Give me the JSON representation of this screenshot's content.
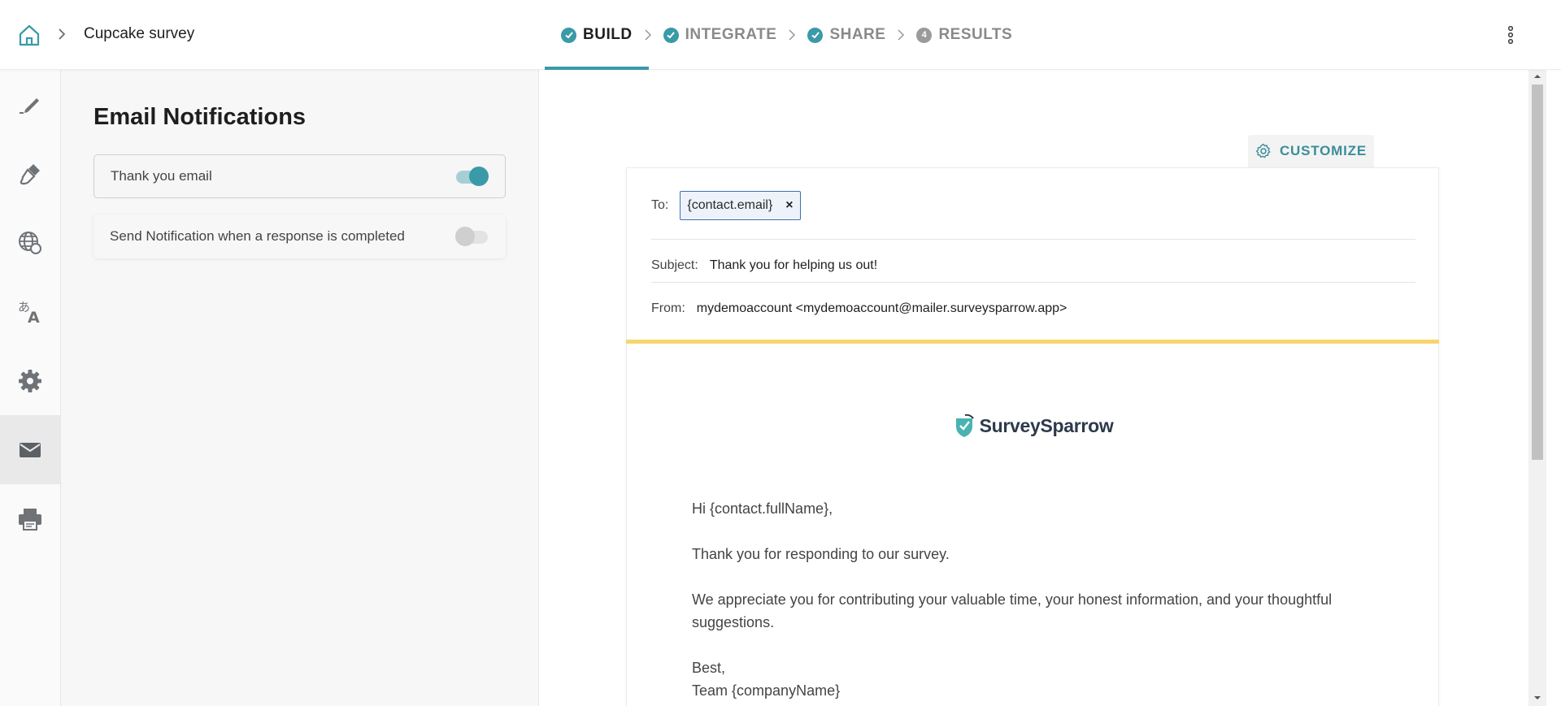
{
  "header": {
    "survey_title": "Cupcake survey",
    "steps": [
      {
        "label": "BUILD",
        "state": "done",
        "active": true
      },
      {
        "label": "INTEGRATE",
        "state": "done"
      },
      {
        "label": "SHARE",
        "state": "done"
      },
      {
        "label": "RESULTS",
        "state": "pending",
        "number": "4"
      }
    ]
  },
  "sidebar": {
    "items": [
      {
        "icon": "pen-icon"
      },
      {
        "icon": "paint-brush-icon"
      },
      {
        "icon": "globe-icon"
      },
      {
        "icon": "translate-icon"
      },
      {
        "icon": "gear-icon"
      },
      {
        "icon": "envelope-icon",
        "active": true
      },
      {
        "icon": "printer-icon"
      }
    ]
  },
  "panel": {
    "title": "Email Notifications",
    "toggles": [
      {
        "label": "Thank you email",
        "enabled": true
      },
      {
        "label": "Send Notification when a response is completed",
        "enabled": false
      }
    ]
  },
  "preview": {
    "customize_label": "CUSTOMIZE",
    "to_label": "To:",
    "to_chip": "{contact.email}",
    "chip_remove": "×",
    "subject_label": "Subject:",
    "subject_value": "Thank you for helping us out!",
    "from_label": "From:",
    "from_value": "mydemoaccount <mydemoaccount@mailer.surveysparrow.app>",
    "logo_text": "SurveySparrow",
    "greeting": "Hi {contact.fullName},",
    "para1": "Thank you for responding to our survey.",
    "para2": "We appreciate you for contributing your valuable time, your honest information, and your thoughtful suggestions.",
    "signoff1": "Best,",
    "signoff2": "Team {companyName}"
  },
  "colors": {
    "accent": "#3a9aa8",
    "highlight_bar": "#f6d56e",
    "chip_border": "#3e6fb4"
  }
}
